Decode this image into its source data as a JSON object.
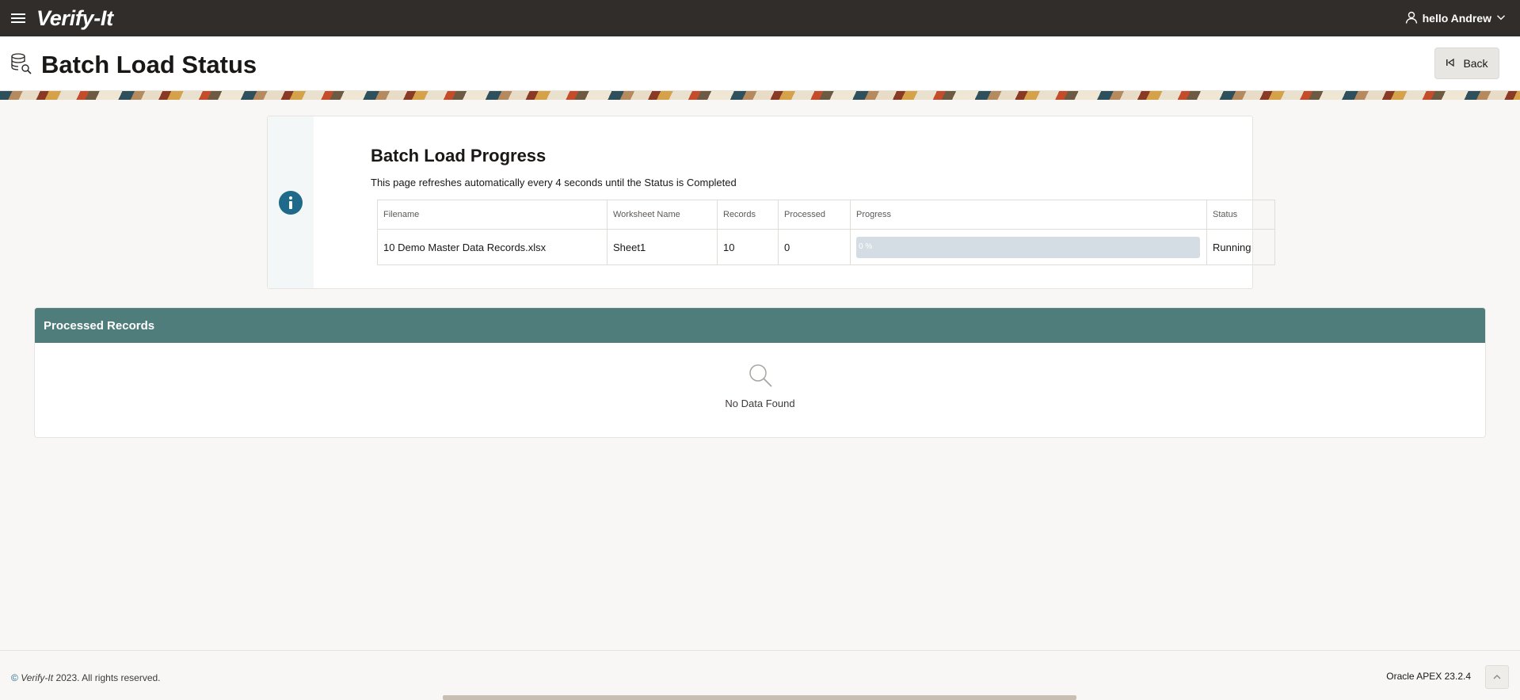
{
  "topbar": {
    "app_title": "Verify-It",
    "user_label": "hello Andrew"
  },
  "hero": {
    "title": "Batch Load Status",
    "back_label": "Back"
  },
  "alert": {
    "title": "Batch Load Progress",
    "text": "This page refreshes automatically every 4 seconds until the Status is Completed",
    "table": {
      "headers": {
        "filename": "Filename",
        "worksheet": "Worksheet Name",
        "records": "Records",
        "processed": "Processed",
        "progress": "Progress",
        "status": "Status"
      },
      "row": {
        "filename": "10 Demo Master Data Records.xlsx",
        "worksheet": "Sheet1",
        "records": "10",
        "processed": "0",
        "progress_label": "0 %",
        "progress_value": 0,
        "status": "Running"
      }
    }
  },
  "records_region": {
    "title": "Processed Records",
    "empty_text": "No Data Found"
  },
  "footer": {
    "copyright_symbol": "©",
    "brand": "Verify-It",
    "copyright_rest": "2023. All rights reserved.",
    "version": "Oracle APEX 23.2.4"
  },
  "colors": {
    "topbar": "#312d2a",
    "region_header": "#4f7d7b",
    "info_accent": "#1f6a8a",
    "progress_track": "#d4dde3"
  },
  "icons": {
    "menu": "hamburger-icon",
    "user": "user-icon",
    "chevron": "chevron-down-icon",
    "page": "database-search-icon",
    "back": "skip-back-icon",
    "info": "info-icon",
    "empty": "search-icon",
    "top": "chevron-up-icon"
  }
}
